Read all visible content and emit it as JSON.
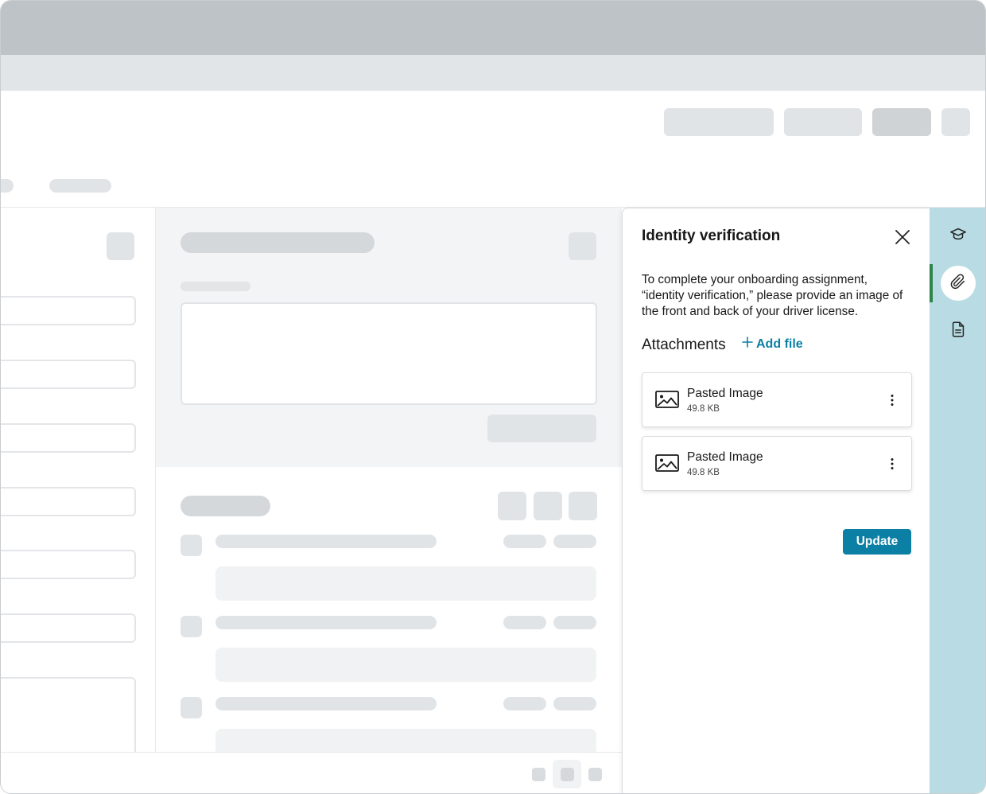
{
  "panel": {
    "title": "Identity verification",
    "description": "To complete your onboarding assignment, “identity verification,” please provide an image of the front and back of your driver license.",
    "attachments_label": "Attachments",
    "add_file_label": "Add file",
    "files": [
      {
        "name": "Pasted Image",
        "size": "49.8 KB"
      },
      {
        "name": "Pasted Image",
        "size": "49.8 KB"
      }
    ],
    "update_label": "Update"
  },
  "rail": {
    "items": [
      {
        "icon": "graduation-cap-icon",
        "active": false
      },
      {
        "icon": "paperclip-icon",
        "active": true
      },
      {
        "icon": "document-icon",
        "active": false
      }
    ]
  },
  "colors": {
    "accent": "#0b7fa4",
    "rail_background": "#b8dbe4",
    "active_indicator": "#2e844a"
  }
}
